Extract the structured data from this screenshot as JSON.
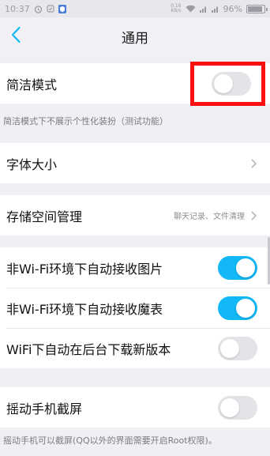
{
  "status_bar": {
    "time": "10:37",
    "speed": "0.16\nKB/s",
    "battery_percent": "96%",
    "battery_level": 0.96,
    "icons": [
      "alarm-icon",
      "notification-icon",
      "app-shield-icon",
      "wifi-icon",
      "signal-icon",
      "signal-icon-2"
    ]
  },
  "nav": {
    "title": "通用",
    "back_icon": "chevron-left-icon"
  },
  "simple_mode": {
    "label": "简洁模式",
    "enabled": false,
    "caption": "简洁模式下不展示个性化装扮（测试功能）"
  },
  "font_size": {
    "label": "字体大小"
  },
  "storage": {
    "label": "存储空间管理",
    "hint": "聊天记录、文件清理"
  },
  "auto_receive": [
    {
      "label": "非Wi-Fi环境下自动接收图片",
      "enabled": true
    },
    {
      "label": "非Wi-Fi环境下自动接收魔表",
      "enabled": true
    },
    {
      "label": "WiFi下自动在后台下载新版本",
      "enabled": false
    }
  ],
  "shake": {
    "label": "摇动手机截屏",
    "enabled": false,
    "caption": "摇动手机可以截屏(QQ以外的界面需要开启Root权限)。"
  },
  "colors": {
    "accent": "#12b7f5",
    "highlight": "#ff1010",
    "background": "#efeff4"
  }
}
